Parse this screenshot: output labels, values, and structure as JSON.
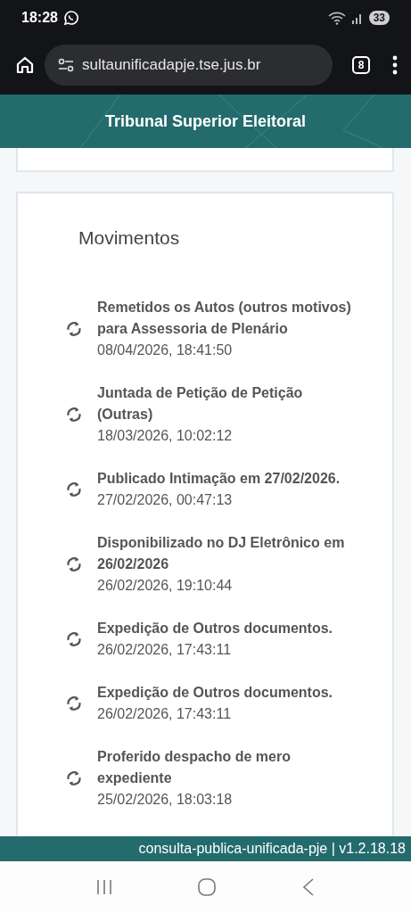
{
  "status_bar": {
    "time": "18:28",
    "battery": "33"
  },
  "browser": {
    "url": "sultaunificadapje.tse.jus.br",
    "tab_count": "8"
  },
  "header": {
    "title": "Tribunal Superior Eleitoral"
  },
  "movimentos": {
    "title": "Movimentos",
    "items": [
      {
        "description": "Remetidos os Autos (outros motivos) para Assessoria de Plenário",
        "datetime": "08/04/2026, 18:41:50"
      },
      {
        "description": "Juntada de Petição de Petição (Outras)",
        "datetime": "18/03/2026, 10:02:12"
      },
      {
        "description": "Publicado Intimação em 27/02/2026.",
        "datetime": "27/02/2026, 00:47:13"
      },
      {
        "description": "Disponibilizado no DJ Eletrônico em 26/02/2026",
        "datetime": "26/02/2026, 19:10:44"
      },
      {
        "description": "Expedição de Outros documentos.",
        "datetime": "26/02/2026, 17:43:11"
      },
      {
        "description": "Expedição de Outros documentos.",
        "datetime": "26/02/2026, 17:43:11"
      },
      {
        "description": "Proferido despacho de mero expediente",
        "datetime": "25/02/2026, 18:03:18"
      }
    ]
  },
  "footer": {
    "text": "consulta-publica-unificada-pje | v1.2.18.18"
  }
}
